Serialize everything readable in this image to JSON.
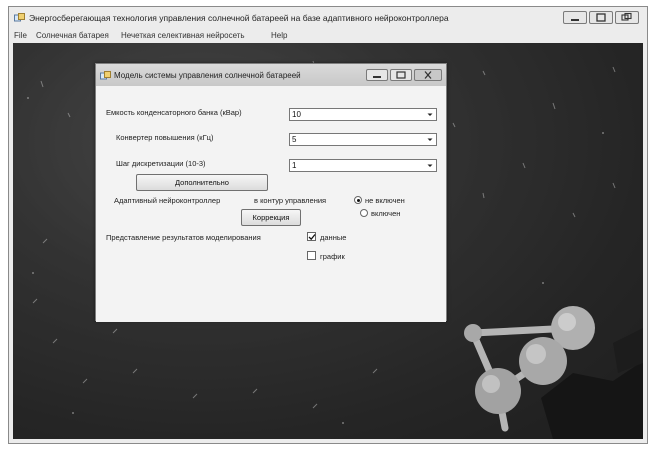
{
  "window": {
    "title": "Энергосберегающая технология управления солнечной батареей на базе адаптивного нейроконтроллера"
  },
  "menu": [
    "File",
    "Солнечная батарея",
    "Нечеткая селективная нейросеть",
    "Help"
  ],
  "dialog": {
    "title": "Модель системы управления солнечной батареей",
    "fields": [
      {
        "label": "Емкость конденсаторного банка (кВар)",
        "value": "10"
      },
      {
        "label": "Конвертер повышения  (кГц)",
        "value": "5"
      },
      {
        "label": "Шаг дискретизации (10-3)",
        "value": "1"
      }
    ],
    "extra_button": "Дополнительно",
    "neuro_label": "Адаптивный нейроконтроллер",
    "loop_label": "в контур управления",
    "radio_options": [
      {
        "label": "не включен",
        "selected": true
      },
      {
        "label": "включен",
        "selected": false
      }
    ],
    "correction_button": "Коррекция",
    "results_label": "Представление результатов моделирования",
    "checkboxes": [
      {
        "label": "данные",
        "checked": true
      },
      {
        "label": "график",
        "checked": false
      }
    ]
  }
}
